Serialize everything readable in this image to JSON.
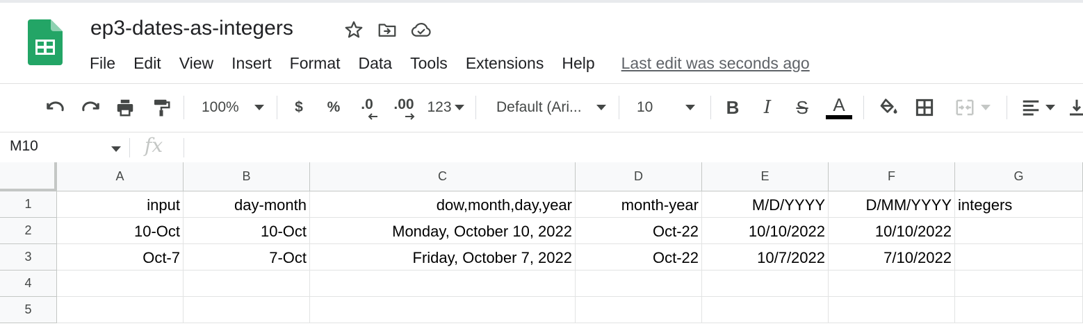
{
  "app": {
    "doc_title": "ep3-dates-as-integers",
    "icons": [
      "star-icon",
      "move-to-folder-icon",
      "cloud-saved-icon"
    ]
  },
  "menu": {
    "items": [
      "File",
      "Edit",
      "View",
      "Insert",
      "Format",
      "Data",
      "Tools",
      "Extensions",
      "Help"
    ],
    "last_edit": "Last edit was seconds ago"
  },
  "toolbar": {
    "zoom": "100%",
    "currency": "$",
    "percent": "%",
    "decrease_decimal": ".0",
    "increase_decimal": ".00",
    "more_formats": "123",
    "font_family": "Default (Ari...",
    "font_size": "10",
    "bold": "B",
    "italic": "I",
    "strikethrough": "S",
    "text_color_letter": "A",
    "text_color": "#000000"
  },
  "formula_bar": {
    "name_box": "M10",
    "fx_label": "fx",
    "formula": ""
  },
  "sheet": {
    "columns": [
      "A",
      "B",
      "C",
      "D",
      "E",
      "F",
      "G"
    ],
    "rows": [
      "1",
      "2",
      "3",
      "4",
      "5"
    ],
    "cells": [
      [
        "input",
        "day-month",
        "dow,month,day,year",
        "month-year",
        "M/D/YYYY",
        "D/MM/YYYY",
        "integers"
      ],
      [
        "10-Oct",
        "10-Oct",
        "Monday, October 10, 2022",
        "Oct-22",
        "10/10/2022",
        "10/10/2022",
        ""
      ],
      [
        "Oct-7",
        "7-Oct",
        "Friday, October 7, 2022",
        "Oct-22",
        "10/7/2022",
        "7/10/2022",
        ""
      ],
      [
        "",
        "",
        "",
        "",
        "",
        "",
        ""
      ],
      [
        "",
        "",
        "",
        "",
        "",
        "",
        ""
      ]
    ]
  },
  "colors": {
    "sheets_green": "#23a566",
    "gridline": "#e2e3e3",
    "header_bg": "#f8f9fa"
  }
}
